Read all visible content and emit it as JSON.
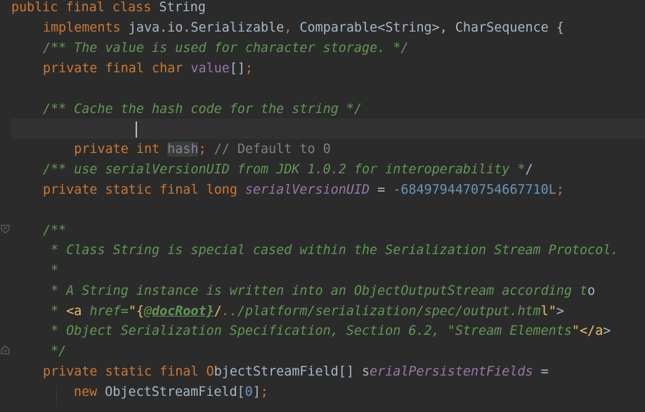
{
  "lines": [
    "public final class String",
    "implements java.io.Serializable, Comparable<String>, CharSequence {",
    "/** The value is used for character storage. */",
    "private final char value[];",
    "",
    "/** Cache the hash code for the string */",
    "private int hash; // Default to 0",
    "",
    "/** use serialVersionUID from JDK 1.0.2 for interoperability */",
    "private static final long serialVersionUID = -6849794470754667710L;",
    "",
    "/**",
    " * Class String is special cased within the Serialization Stream Protocol.",
    " *",
    " * A String instance is written into an ObjectOutputStream according to",
    " * <a href=\"{@docRoot}/../platform/serialization/spec/output.html\">",
    " * Object Serialization Specification, Section 6.2, \"Stream Elements\"</a>",
    " */",
    "private static final ObjectStreamField[] serialPersistentFields =",
    "new ObjectStreamField[0];"
  ],
  "icons": {
    "intention": "lightbulb-icon",
    "fold_start": "fold-start-icon",
    "fold_end": "fold-end-icon"
  },
  "colors": {
    "background": "#2b2b2b",
    "keyword": "#cc7832",
    "doc_comment": "#629755",
    "line_comment": "#808080",
    "field": "#9876aa",
    "number": "#6897bb",
    "html_tag": "#e8bf6a",
    "default_text": "#a9b7c6",
    "intention_bulb": "#f4af3d"
  }
}
